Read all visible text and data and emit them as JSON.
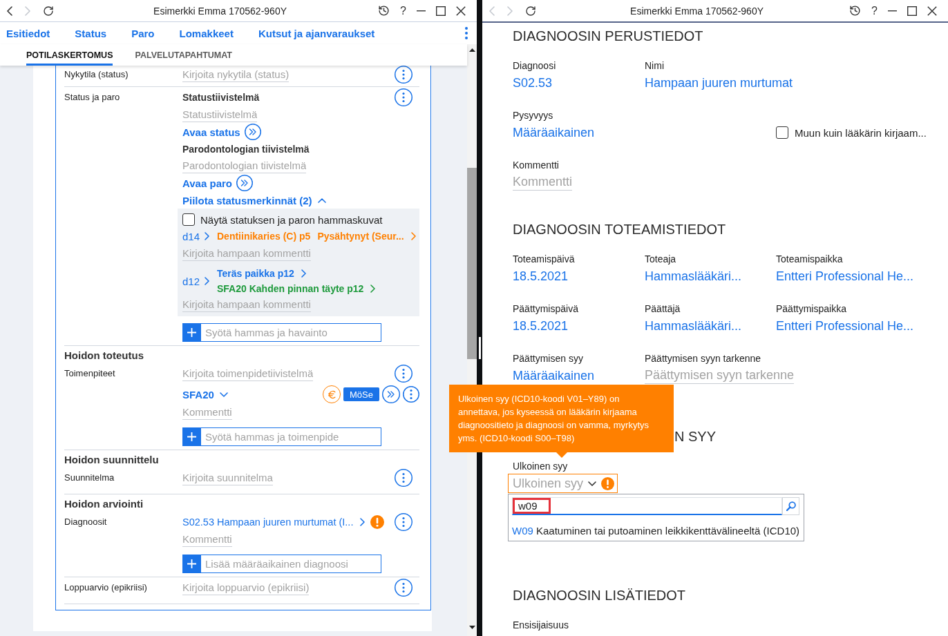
{
  "left_window": {
    "title": "Esimerkki Emma 170562-960Y",
    "back_disabled": false,
    "forward_disabled": true,
    "help": "?",
    "nav_links": [
      "Esitiedot",
      "Status",
      "Paro",
      "Lomakkeet",
      "Kutsut ja ajanvaraukset"
    ],
    "tabs": [
      {
        "label": "POTILASKERTOMUS",
        "selected": true
      },
      {
        "label": "PALVELUTAPAHTUMAT",
        "selected": false
      }
    ],
    "sections": [
      {
        "rows": [
          {
            "label": "Nykytila (status)",
            "items": [
              {
                "kind": "text_field",
                "placeholder": "Kirjoita nykytila (status)"
              }
            ]
          },
          {
            "label": "Status ja paro",
            "items": [
              {
                "kind": "subheading",
                "text": "Statustiivistelmä"
              },
              {
                "kind": "text_field",
                "placeholder": "Statustiivistelmä"
              },
              {
                "kind": "link",
                "text": "Avaa status"
              },
              {
                "kind": "subheading",
                "text": "Parodontologian tiivistelmä"
              },
              {
                "kind": "text_field",
                "placeholder": "Parodontologian tiivistelmä"
              },
              {
                "kind": "link",
                "text": "Avaa paro"
              },
              {
                "kind": "toggle",
                "text": "Piilota statusmerkinnät (2)",
                "expanded": true,
                "findings": {
                  "checkbox": {
                    "label": "Näytä statuksen ja paron hammaskuvat",
                    "checked": false
                  },
                  "teeth": [
                    {
                      "tooth": "d14",
                      "entries": [
                        {
                          "parts": [
                            "Dentiinikaries (C) p5",
                            "Pysähtynyt (Seur..."
                          ],
                          "color": "#ff8000"
                        }
                      ],
                      "comment": {
                        "placeholder": "Kirjoita hampaan kommentti"
                      }
                    },
                    {
                      "tooth": "d12",
                      "entries": [
                        {
                          "parts": [
                            "Teräs paikka p12"
                          ],
                          "color": "#1a73e8"
                        },
                        {
                          "parts": [
                            "SFA20 Kahden pinnan täyte p12"
                          ],
                          "color": "#1e9a3c"
                        }
                      ],
                      "comment": {
                        "placeholder": "Kirjoita hampaan kommentti"
                      }
                    }
                  ]
                }
              },
              {
                "kind": "add_field",
                "placeholder": "Syötä hammas ja havainto"
              }
            ]
          }
        ]
      },
      {
        "heading": "Hoidon toteutus",
        "rows": [
          {
            "label": "Toimenpiteet",
            "items": [
              {
                "kind": "text_field",
                "placeholder": "Kirjoita toimenpidetiivistelmä"
              },
              {
                "kind": "procedure",
                "code": "SFA20",
                "button": "MöSe"
              },
              {
                "kind": "text_field",
                "placeholder": "Kommentti"
              },
              {
                "kind": "add_field",
                "placeholder": "Syötä hammas ja toimenpide"
              }
            ]
          }
        ]
      },
      {
        "heading": "Hoidon suunnittelu",
        "rows": [
          {
            "label": "Suunnitelma",
            "items": [
              {
                "kind": "text_field",
                "placeholder": "Kirjoita suunnitelma"
              }
            ]
          }
        ]
      },
      {
        "heading": "Hoidon arviointi",
        "rows": [
          {
            "label": "Diagnoosit",
            "items": [
              {
                "kind": "diagnosis",
                "text": "S02.53 Hampaan juuren murtumat (I...",
                "warning": true
              },
              {
                "kind": "text_field",
                "placeholder": "Kommentti"
              },
              {
                "kind": "add_field",
                "placeholder": "Lisää määräaikainen diagnoosi"
              }
            ]
          },
          {
            "label": "Loppuarvio (epikriisi)",
            "items": [
              {
                "kind": "text_field",
                "placeholder": "Kirjoita loppuarvio (epikriisi)"
              }
            ]
          }
        ]
      }
    ]
  },
  "right_window": {
    "title": "Esimerkki Emma 170562-960Y",
    "back_disabled": true,
    "forward_disabled": true,
    "help": "?",
    "sections": [
      {
        "heading": {
          "text": "DIAGNOOSIN PERUSTIEDOT"
        },
        "rows": [
          {
            "fields": [
              {
                "kind": "value",
                "label": "Diagnoosi",
                "value": "S02.53"
              },
              {
                "kind": "value",
                "label": "Nimi",
                "value": "Hampaan juuren murtumat"
              }
            ]
          },
          {
            "fields": [
              {
                "kind": "value",
                "label": "Pysyvyys",
                "value": "Määräaikainen"
              },
              {
                "kind": "checkbox",
                "label": "Muun kuin lääkärin kirjaam...",
                "checked": false
              }
            ]
          },
          {
            "fields": [
              {
                "kind": "text_field",
                "label": "Kommentti",
                "placeholder": "Kommentti"
              }
            ]
          }
        ]
      },
      {
        "heading": {
          "text": "DIAGNOOSIN TOTEAMISTIEDOT"
        },
        "rows": [
          {
            "fields": [
              {
                "kind": "value",
                "label": "Toteamispäivä",
                "value": "18.5.2021"
              },
              {
                "kind": "value",
                "label": "Toteaja",
                "value": "Hammaslääkäri..."
              },
              {
                "kind": "value",
                "label": "Toteamispaikka",
                "value": "Entteri Professional He..."
              }
            ]
          },
          {
            "fields": [
              {
                "kind": "value",
                "label": "Päättymispäivä",
                "value": "18.5.2021"
              },
              {
                "kind": "value",
                "label": "Päättäjä",
                "value": "Hammaslääkäri..."
              },
              {
                "kind": "value",
                "label": "Päättymispaikka",
                "value": "Entteri Professional He..."
              }
            ]
          },
          {
            "fields": [
              {
                "kind": "value",
                "label": "Päättymisen syy",
                "value": "Määräaikainen"
              },
              {
                "kind": "text_field",
                "label": "Päättymisen syyn tarkenne",
                "placeholder": "Päättymisen syyn tarkenne"
              }
            ]
          }
        ]
      },
      {
        "heading": {
          "text": "N SYY",
          "obscured": true
        },
        "rows": [
          {
            "fields": [
              {
                "kind": "select",
                "label": "Ulkoinen syy",
                "placeholder": "Ulkoinen syy",
                "warning": true,
                "open": true,
                "search": {
                  "value": "w09",
                  "highlighted": true
                },
                "options": [
                  {
                    "code": "W09",
                    "text": "Kaatuminen tai putoaminen leikkikenttävälineeltä (ICD10)"
                  }
                ]
              }
            ]
          }
        ]
      },
      {
        "heading": {
          "text": "DIAGNOOSIN LISÄTIEDOT"
        },
        "rows": [
          {
            "fields": [
              {
                "kind": "label",
                "label": "Ensisijaisuus"
              }
            ]
          }
        ]
      }
    ]
  },
  "tooltip": {
    "text": "Ulkoinen syy (ICD10-koodi V01–Y89) on annettava, jos kyseessä on lääkärin kirjaama diagnoositieto ja diagnoosi on vamma, myrkytys yms. (ICD10-koodi S00–T98)"
  }
}
